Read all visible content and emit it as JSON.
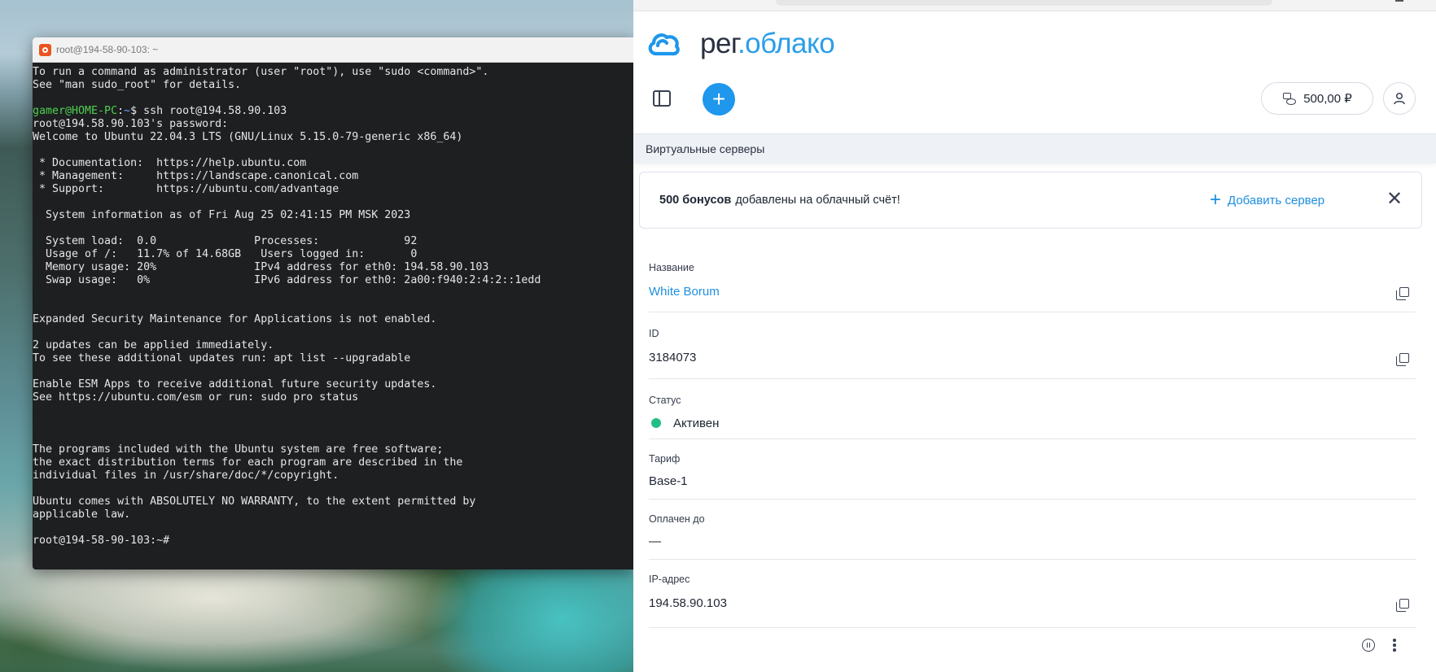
{
  "terminal": {
    "title": "root@194-58-90-103: ~",
    "lines": [
      {
        "t": "To run a command as administrator (user \"root\"), use \"sudo <command>\"."
      },
      {
        "t": "See \"man sudo_root\" for details."
      },
      {
        "t": ""
      },
      {
        "user": "gamer@HOME-PC",
        "colon": ":",
        "path": "~",
        "t": "$ ssh root@194.58.90.103"
      },
      {
        "t": "root@194.58.90.103's password:"
      },
      {
        "t": "Welcome to Ubuntu 22.04.3 LTS (GNU/Linux 5.15.0-79-generic x86_64)"
      },
      {
        "t": ""
      },
      {
        "t": " * Documentation:  https://help.ubuntu.com"
      },
      {
        "t": " * Management:     https://landscape.canonical.com"
      },
      {
        "t": " * Support:        https://ubuntu.com/advantage"
      },
      {
        "t": ""
      },
      {
        "t": "  System information as of Fri Aug 25 02:41:15 PM MSK 2023"
      },
      {
        "t": ""
      },
      {
        "t": "  System load:  0.0               Processes:             92"
      },
      {
        "t": "  Usage of /:   11.7% of 14.68GB   Users logged in:       0"
      },
      {
        "t": "  Memory usage: 20%               IPv4 address for eth0: 194.58.90.103"
      },
      {
        "t": "  Swap usage:   0%                IPv6 address for eth0: 2a00:f940:2:4:2::1edd"
      },
      {
        "t": ""
      },
      {
        "t": ""
      },
      {
        "t": "Expanded Security Maintenance for Applications is not enabled."
      },
      {
        "t": ""
      },
      {
        "t": "2 updates can be applied immediately."
      },
      {
        "t": "To see these additional updates run: apt list --upgradable"
      },
      {
        "t": ""
      },
      {
        "t": "Enable ESM Apps to receive additional future security updates."
      },
      {
        "t": "See https://ubuntu.com/esm or run: sudo pro status"
      },
      {
        "t": ""
      },
      {
        "t": ""
      },
      {
        "t": ""
      },
      {
        "t": "The programs included with the Ubuntu system are free software;"
      },
      {
        "t": "the exact distribution terms for each program are described in the"
      },
      {
        "t": "individual files in /usr/share/doc/*/copyright."
      },
      {
        "t": ""
      },
      {
        "t": "Ubuntu comes with ABSOLUTELY NO WARRANTY, to the extent permitted by"
      },
      {
        "t": "applicable law."
      },
      {
        "t": ""
      },
      {
        "t": "root@194-58-90-103:~#"
      }
    ]
  },
  "panel": {
    "logo_part1": "рег",
    "logo_part2": ".облако",
    "balance": "500,00 ₽",
    "section": "Виртуальные серверы",
    "notice_bold": "500 бонусов",
    "notice_text": "добавлены на облачный счёт!",
    "notice_action": "Добавить сервер",
    "fields": {
      "name_label": "Название",
      "name_value": "White Borum",
      "id_label": "ID",
      "id_value": "3184073",
      "status_label": "Статус",
      "status_value": "Активен",
      "tariff_label": "Тариф",
      "tariff_value": "Base-1",
      "paid_label": "Оплачен до",
      "paid_value": "—",
      "ip_label": "IP-адрес",
      "ip_value": "194.58.90.103"
    }
  },
  "colors": {
    "accent": "#1e97ec",
    "status_active": "#1fbf84",
    "terminal_bg": "#1d1f21",
    "prompt_user": "#4fd14f",
    "prompt_path": "#6fa6ff"
  },
  "icons": [
    "terminal-app-icon",
    "cloud-logo-icon",
    "sidebar-toggle-icon",
    "plus-icon",
    "wallet-icon",
    "user-icon",
    "close-icon",
    "copy-icon",
    "pause-icon",
    "more-vertical-icon"
  ]
}
